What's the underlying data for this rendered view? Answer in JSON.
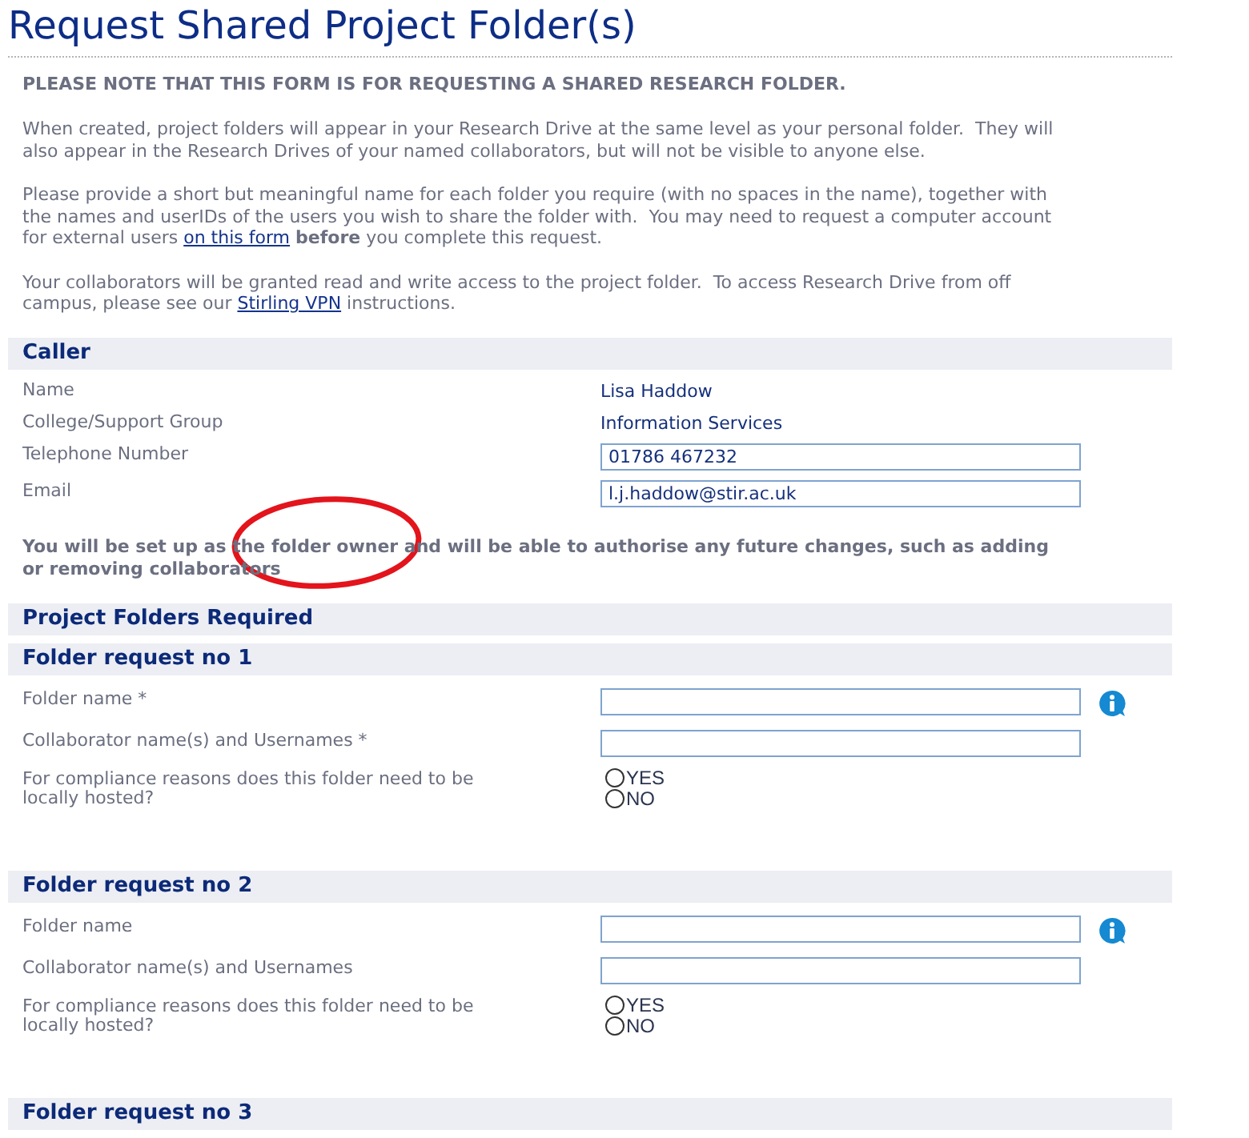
{
  "page": {
    "title": "Request Shared Project Folder(s)"
  },
  "intro": {
    "notice": "PLEASE NOTE THAT THIS FORM IS FOR REQUESTING A SHARED RESEARCH FOLDER.",
    "paragraphs": [
      {
        "parts": [
          {
            "kind": "text",
            "text": "When created, project folders will appear in your Research Drive at the same level as your personal folder.  They will also appear in the Research Drives of your named collaborators, but will not be visible to anyone else."
          }
        ]
      },
      {
        "parts": [
          {
            "kind": "text",
            "text": "Please provide a short but meaningful name for each folder you require (with no spaces in the name), together with the names and userIDs of the users you wish to share the folder with.  You may need to request a computer account for external users "
          },
          {
            "kind": "link",
            "text": "on this form"
          },
          {
            "kind": "text",
            "text": " **before** you complete this request."
          }
        ]
      },
      {
        "parts": [
          {
            "kind": "text",
            "text": "Your collaborators will be granted read and write access to the project folder.  To access Research Drive from off campus, please see our "
          },
          {
            "kind": "link",
            "text": "Stirling VPN"
          },
          {
            "kind": "text",
            "text": " instructions."
          }
        ]
      }
    ]
  },
  "caller": {
    "title": "Caller",
    "fields": [
      {
        "kind": "static",
        "label": "Name",
        "value": "Lisa Haddow"
      },
      {
        "kind": "static",
        "label": "College/Support Group",
        "value": "Information Services"
      },
      {
        "kind": "input",
        "label": "Telephone Number",
        "value": "01786 467232"
      },
      {
        "kind": "input",
        "label": "Email",
        "value": "l.j.haddow@stir.ac.uk"
      }
    ],
    "note": "You will be set up as the folder owner and will be able to authorise any future changes, such as adding or removing collaborators"
  },
  "annotation": {
    "kind": "ellipse",
    "color": "#e3141c"
  },
  "projects": {
    "title": "Project Folders Required",
    "requests": [
      {
        "title": "Folder request no 1",
        "fields": [
          {
            "kind": "input",
            "label": "Folder name *",
            "info": true
          },
          {
            "kind": "input",
            "label": "Collaborator name(s) and Usernames *"
          },
          {
            "kind": "radio",
            "label": "For compliance reasons does this folder need to be locally hosted?",
            "options": [
              {
                "label": "YES",
                "selected": false
              },
              {
                "label": "NO",
                "selected": false
              }
            ]
          }
        ]
      },
      {
        "title": "Folder request no 2",
        "fields": [
          {
            "kind": "input",
            "label": "Folder name",
            "info": true
          },
          {
            "kind": "input",
            "label": "Collaborator name(s) and Usernames"
          },
          {
            "kind": "radio",
            "label": "For compliance reasons does this folder need to be locally hosted?",
            "options": [
              {
                "label": "YES",
                "selected": false
              },
              {
                "label": "NO",
                "selected": false
              }
            ]
          }
        ]
      },
      {
        "title": "Folder request no 3"
      }
    ]
  }
}
